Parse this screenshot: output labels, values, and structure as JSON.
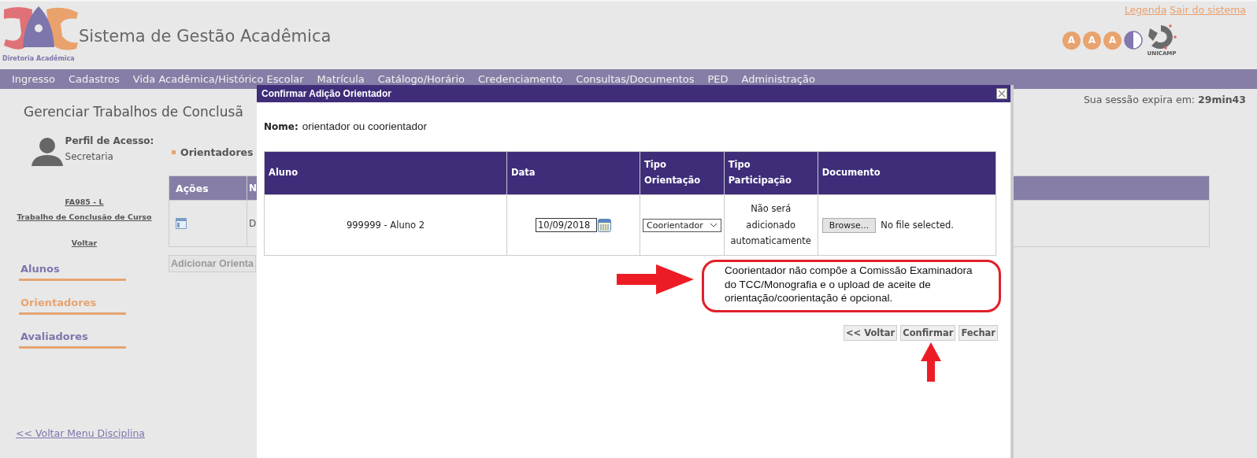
{
  "header": {
    "logo_caption": "Diretoria Acadêmica",
    "title": "Sistema de Gestão Acadêmica",
    "links": [
      "Legenda",
      "Sair do sistema"
    ],
    "badge_letters": [
      "A",
      "A",
      "A"
    ],
    "university": "UNICAMP"
  },
  "menu": [
    "Ingresso",
    "Cadastros",
    "Vida Acadêmica/Histórico Escolar",
    "Matrícula",
    "Catálogo/Horário",
    "Credenciamento",
    "Consultas/Documentos",
    "PED",
    "Administração"
  ],
  "session": {
    "label": "Sua sessão expira em:",
    "time": "29min43"
  },
  "page_title": "Gerenciar Trabalhos de Conclusã",
  "profile": {
    "label": "Perfil de Acesso:",
    "role": "Secretaria"
  },
  "sidebar": {
    "course_code": "FA985 - L",
    "course_name": "Trabalho de Conclusão de Curso",
    "back": "Voltar",
    "items": [
      {
        "label": "Alunos",
        "selected": false
      },
      {
        "label": "Orientadores",
        "selected": true
      },
      {
        "label": "Avaliadores",
        "selected": false
      }
    ],
    "footer_link": "<< Voltar Menu Disciplina"
  },
  "section": {
    "title": "Orientadores",
    "columns": [
      "Ações",
      "N"
    ],
    "row_text": "D",
    "add_button": "Adicionar Orienta"
  },
  "dialog": {
    "title": "Confirmar Adição Orientador",
    "name_label": "Nome:",
    "name_value": "orientador ou coorientador",
    "columns": [
      "Aluno",
      "Data",
      "Tipo Orientação",
      "Tipo Participação",
      "Documento"
    ],
    "row": {
      "student": "999999 - Aluno 2",
      "date": "10/09/2018",
      "orientation": "Coorientador",
      "participation": "Não será adicionado automaticamente",
      "browse": "Browse...",
      "file_status": "No file selected."
    },
    "note": "Coorientador não compõe a Comissão Examinadora do TCC/Monografia e o upload de aceite de orientação/coorientação é opcional.",
    "buttons": [
      "<< Voltar",
      "Confirmar",
      "Fechar"
    ]
  }
}
